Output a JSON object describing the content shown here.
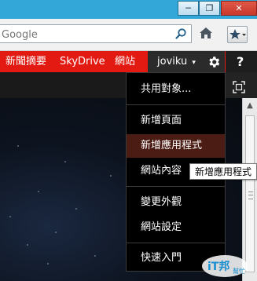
{
  "window": {
    "buttons": {
      "minimize": "─",
      "maximize": "❐",
      "close": "✕"
    }
  },
  "address_bar": {
    "value": "",
    "placeholder": "Google",
    "search_icon": "search-icon",
    "home_icon": "home-icon",
    "favorites_icon": "favorites-star-icon"
  },
  "suite_bar": {
    "links": [
      "新聞摘要",
      "SkyDrive",
      "網站"
    ],
    "user": "joviku",
    "user_caret": "▾",
    "settings_icon": "gear-icon",
    "help": "?"
  },
  "ribbon": {
    "focus_icon": "focus-on-content-icon"
  },
  "settings_menu": {
    "groups": [
      [
        "共用對象..."
      ],
      [
        "新增頁面",
        "新增應用程式",
        "網站內容"
      ],
      [
        "變更外觀",
        "網站設定"
      ],
      [
        "快速入門"
      ]
    ],
    "highlighted": "新增應用程式"
  },
  "tooltip": "新增應用程式",
  "colors": {
    "suite_bar": "#e21a12",
    "title_bar": "#33a7d8",
    "menu_bg": "#000000",
    "menu_highlight": "#4b1c14"
  },
  "watermark": {
    "brand": "iT邦",
    "sub": "幫忙"
  }
}
